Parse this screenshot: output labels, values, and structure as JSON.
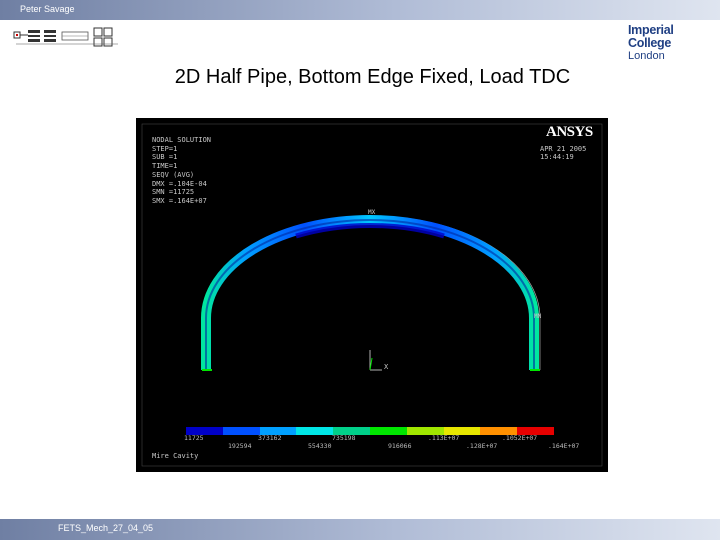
{
  "header": {
    "author": "Peter Savage"
  },
  "logo": {
    "line1": "Imperial College",
    "line2": "London"
  },
  "slide": {
    "title": "2D Half Pipe, Bottom Edge Fixed, Load TDC"
  },
  "simulation": {
    "ansys_logo": "ANSYS",
    "info_lines": [
      "NODAL SOLUTION",
      "STEP=1",
      "SUB =1",
      "TIME=1",
      "SEQV      (AVG)",
      "DMX =.104E-04",
      "SMN =11725",
      "SMX =.164E+07"
    ],
    "date": "APR 21 2005",
    "time": "15:44:19",
    "mx_marker": "MX",
    "mn_marker": "MN",
    "axis_label": "X",
    "legend_top": [
      "11725",
      "373162",
      "735198",
      ".113E+07",
      ".1052E+07"
    ],
    "legend_bottom": [
      "192594",
      "554330",
      "916066",
      ".128E+07",
      ".164E+07"
    ],
    "caption": "Mire Cavity",
    "colors": [
      "#0000c8",
      "#0050ff",
      "#00a0ff",
      "#00e6e6",
      "#00d08a",
      "#00e600",
      "#a0e600",
      "#e6e600",
      "#ff9000",
      "#e60000"
    ]
  },
  "footer": {
    "code": "FETS_Mech_27_04_05"
  }
}
